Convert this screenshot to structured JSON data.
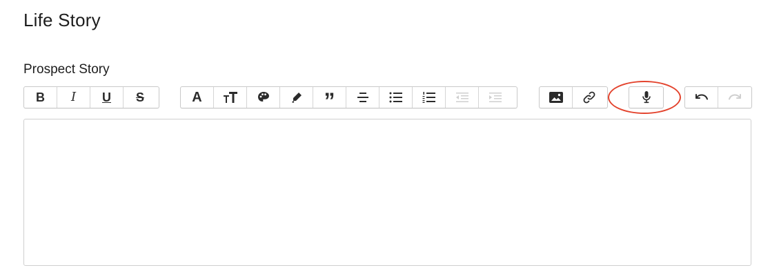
{
  "section": {
    "title": "Life Story"
  },
  "field": {
    "label": "Prospect Story",
    "content": ""
  },
  "toolbar": {
    "groups": [
      {
        "name": "text-style",
        "buttons": [
          {
            "icon": "bold-icon",
            "glyph": "B",
            "title": "Bold",
            "enabled": true
          },
          {
            "icon": "italic-icon",
            "glyph": "I",
            "title": "Italic",
            "enabled": true
          },
          {
            "icon": "underline-icon",
            "glyph": "U",
            "title": "Underline",
            "enabled": true
          },
          {
            "icon": "strikethrough-icon",
            "glyph": "S",
            "title": "Strikethrough",
            "enabled": true
          }
        ]
      },
      {
        "name": "format",
        "buttons": [
          {
            "icon": "font-icon",
            "glyph": "A",
            "title": "Font",
            "enabled": true
          },
          {
            "icon": "font-size-icon",
            "glyph": "TT",
            "title": "Font size",
            "enabled": true
          },
          {
            "icon": "palette-icon",
            "title": "Text color",
            "enabled": true
          },
          {
            "icon": "highlighter-icon",
            "title": "Highlight",
            "enabled": true
          },
          {
            "icon": "quote-icon",
            "glyph": "”",
            "title": "Quote",
            "enabled": true
          },
          {
            "icon": "align-center-icon",
            "title": "Align",
            "enabled": true
          },
          {
            "icon": "bullet-list-icon",
            "title": "Bulleted list",
            "enabled": true
          },
          {
            "icon": "numbered-list-icon",
            "title": "Numbered list",
            "enabled": true
          },
          {
            "icon": "outdent-icon",
            "title": "Decrease indent",
            "enabled": false
          },
          {
            "icon": "indent-icon",
            "title": "Increase indent",
            "enabled": false
          }
        ]
      },
      {
        "name": "insert",
        "buttons": [
          {
            "icon": "image-icon",
            "title": "Insert image",
            "enabled": true
          },
          {
            "icon": "link-icon",
            "title": "Insert link",
            "enabled": true
          }
        ]
      },
      {
        "name": "voice",
        "buttons": [
          {
            "icon": "microphone-icon",
            "title": "Voice input",
            "enabled": true
          }
        ]
      },
      {
        "name": "history",
        "buttons": [
          {
            "icon": "undo-icon",
            "title": "Undo",
            "enabled": true
          },
          {
            "icon": "redo-icon",
            "title": "Redo",
            "enabled": false
          }
        ]
      }
    ]
  },
  "annotation": {
    "target": "microphone-icon",
    "color": "#e3432d",
    "shape": "ellipse"
  }
}
